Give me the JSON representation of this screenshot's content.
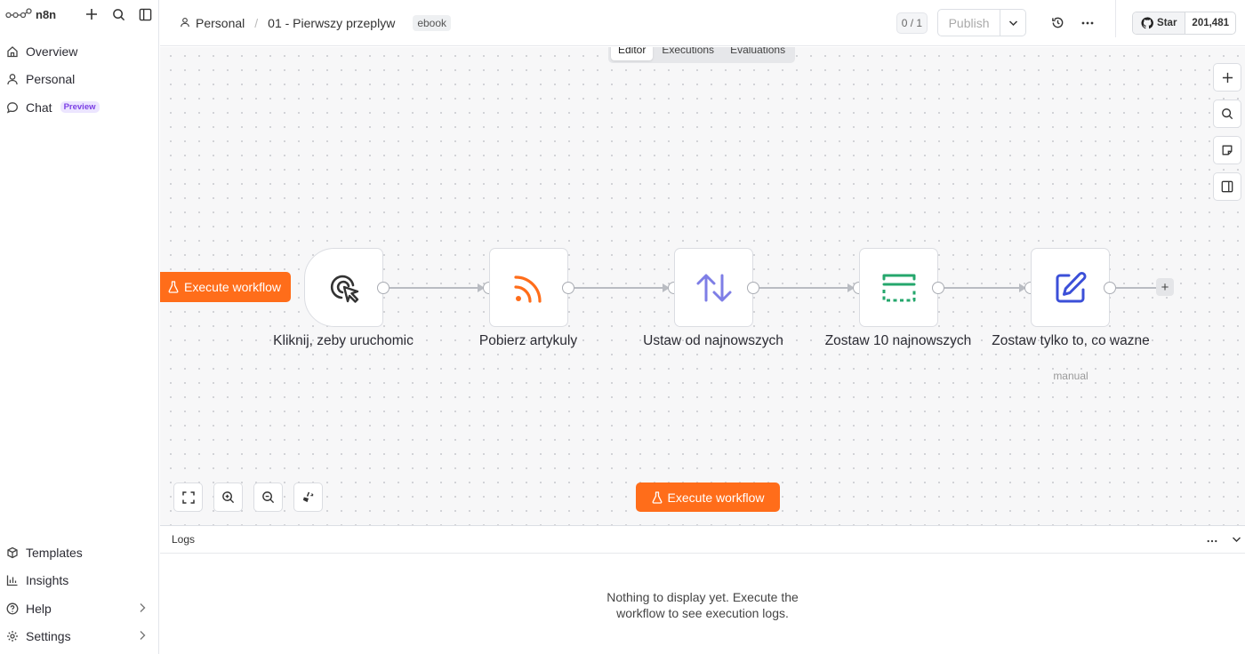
{
  "sidebar": {
    "logo_text": "n8n",
    "items": [
      {
        "label": "Overview",
        "icon": "home-icon"
      },
      {
        "label": "Personal",
        "icon": "user-icon"
      },
      {
        "label": "Chat",
        "icon": "chat-icon",
        "badge": "Preview"
      }
    ],
    "bottom_items": [
      {
        "label": "Templates",
        "icon": "box-icon"
      },
      {
        "label": "Insights",
        "icon": "bar-chart-icon"
      },
      {
        "label": "Help",
        "icon": "help-icon",
        "has_chevron": true
      },
      {
        "label": "Settings",
        "icon": "gear-icon",
        "has_chevron": true
      }
    ]
  },
  "header": {
    "project": "Personal",
    "workflow_name": "01 - Pierwszy przeplyw",
    "tag": "ebook",
    "counter": "0 / 1",
    "publish_label": "Publish",
    "github_star_label": "Star",
    "github_star_count": "201,481"
  },
  "view_tabs": [
    {
      "label": "Editor",
      "active": true
    },
    {
      "label": "Executions",
      "active": false
    },
    {
      "label": "Evaluations",
      "active": false
    }
  ],
  "canvas": {
    "execute_button_label": "Execute workflow",
    "nodes": [
      {
        "label": "Kliknij, zeby uruchomic",
        "icon": "cursor-click-icon",
        "icon_color": "#333333",
        "subtitle": ""
      },
      {
        "label": "Pobierz artykuly",
        "icon": "rss-icon",
        "icon_color": "#ff6d1a",
        "subtitle": ""
      },
      {
        "label": "Ustaw od najnowszych",
        "icon": "sort-arrows-icon",
        "icon_color": "#7e7ee6",
        "subtitle": ""
      },
      {
        "label": "Zostaw 10 najnowszych",
        "icon": "limit-icon",
        "icon_color": "#25a76c",
        "subtitle": ""
      },
      {
        "label": "Zostaw tylko to, co wazne",
        "icon": "edit-icon",
        "icon_color": "#3b4fd8",
        "subtitle": "manual"
      }
    ]
  },
  "logs": {
    "title": "Logs",
    "empty_message": "Nothing to display yet. Execute the workflow to see execution logs."
  },
  "colors": {
    "accent": "#ff6d1a",
    "preview_badge": "#7b3fe4"
  }
}
